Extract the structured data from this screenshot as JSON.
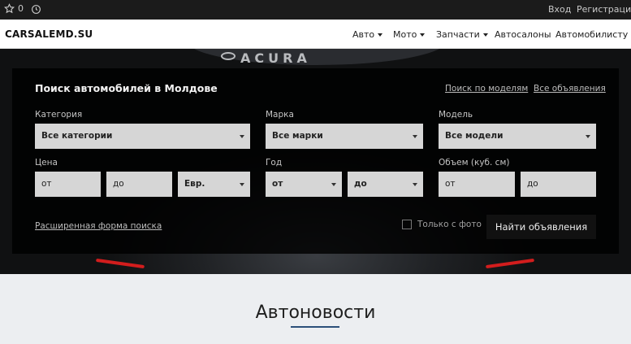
{
  "topbar": {
    "favorites_count": "0",
    "login": "Вход",
    "register": "Регистрация"
  },
  "header": {
    "logo": "CARSALEMD.SU",
    "nav": [
      {
        "label": "Авто",
        "dropdown": true
      },
      {
        "label": "Мото",
        "dropdown": true
      },
      {
        "label": "Запчасти",
        "dropdown": true
      },
      {
        "label": "Автосалоны",
        "dropdown": false
      },
      {
        "label": "Автомобилисту",
        "dropdown": true
      }
    ]
  },
  "hero": {
    "car_brand": "ACURA"
  },
  "search": {
    "title": "Поиск автомобилей в Молдове",
    "link_models": "Поиск по моделям",
    "link_all": "Все объявления",
    "category_label": "Категория",
    "category_value": "Все категории",
    "make_label": "Марка",
    "make_value": "Все марки",
    "model_label": "Модель",
    "model_value": "Все модели",
    "price_label": "Цена",
    "price_from": "от",
    "price_to": "до",
    "currency": "Евр.",
    "year_label": "Год",
    "year_from": "от",
    "year_to": "до",
    "volume_label": "Объем (куб. см)",
    "volume_from": "от",
    "volume_to": "до",
    "advanced_link": "Расширенная форма поиска",
    "photo_only": "Только с фото",
    "submit": "Найти объявления"
  },
  "news": {
    "title": "Автоновости"
  },
  "colors": {
    "panel_bg": "#000000",
    "field_bg": "#d6d6d6",
    "accent_underline": "#2c4f7a",
    "taillight": "#d21d1d"
  }
}
